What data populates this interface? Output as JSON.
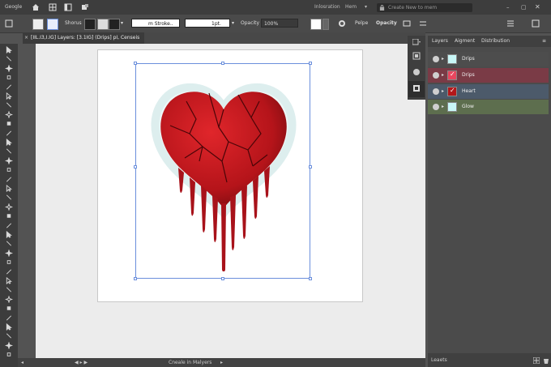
{
  "menubar": {
    "app_label": "Geogle",
    "workspace_label": "Inlosration",
    "workspace_select": "Hem",
    "search_placeholder": "Create New to mem"
  },
  "controlbar": {
    "shortcuts_label": "Shorus",
    "stroke_field": "m Stroke..",
    "stroke_weight": "1pt.",
    "opacity_label": "Opacity",
    "opacity_value": "100%",
    "extra_label": "Pelpe",
    "opacity_label2": "Opacity"
  },
  "document": {
    "tab_title": "[IIL.I3,I.IG] Layers: [3.1IG] (Drips] pI, Censeis"
  },
  "layers_panel": {
    "tabs": [
      "Layers",
      "Aigment",
      "Distribution"
    ],
    "layers": [
      {
        "name": "Drips",
        "color": "#4d4d4d",
        "thumb": "#c8f7f7",
        "checked": false
      },
      {
        "name": "Drips",
        "color": "#7a3b46",
        "thumb": "#e8465e",
        "checked": true
      },
      {
        "name": "Heart",
        "color": "#4c5a6a",
        "thumb": "#b3171a",
        "checked": true
      },
      {
        "name": "Glow",
        "color": "#5d6e4e",
        "thumb": "#c8f7f7",
        "checked": false
      }
    ],
    "footer_label": "Leaets"
  },
  "statusbar": {
    "center_text": "Cneale in Malyers"
  },
  "colors": {
    "selection": "#6b8fdc",
    "heart_red": "#c0161c"
  }
}
